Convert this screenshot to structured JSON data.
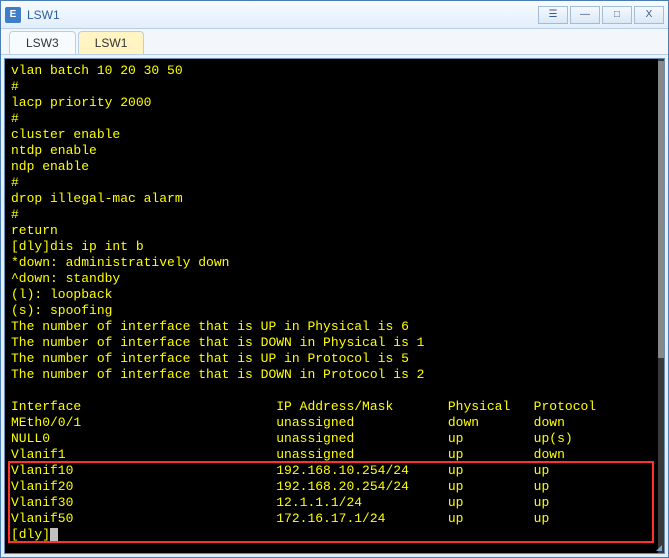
{
  "window": {
    "title": "LSW1",
    "icon_letter": "E",
    "buttons": {
      "menu": "☰",
      "min": "—",
      "max": "□",
      "close": "X"
    }
  },
  "tabs": [
    {
      "label": "LSW3",
      "active": false
    },
    {
      "label": "LSW1",
      "active": true
    }
  ],
  "terminal": {
    "lines": [
      "vlan batch 10 20 30 50",
      "#",
      "lacp priority 2000",
      "#",
      "cluster enable",
      "ntdp enable",
      "ndp enable",
      "#",
      "drop illegal-mac alarm",
      "#",
      "return",
      "[dly]dis ip int b",
      "*down: administratively down",
      "^down: standby",
      "(l): loopback",
      "(s): spoofing",
      "The number of interface that is UP in Physical is 6",
      "The number of interface that is DOWN in Physical is 1",
      "The number of interface that is UP in Protocol is 5",
      "The number of interface that is DOWN in Protocol is 2",
      ""
    ],
    "table_header": {
      "c0": "Interface",
      "c1": "IP Address/Mask",
      "c2": "Physical",
      "c3": "Protocol"
    },
    "rows": [
      {
        "c0": "MEth0/0/1",
        "c1": "unassigned",
        "c2": "down",
        "c3": "down"
      },
      {
        "c0": "NULL0",
        "c1": "unassigned",
        "c2": "up",
        "c3": "up(s)"
      },
      {
        "c0": "Vlanif1",
        "c1": "unassigned",
        "c2": "up",
        "c3": "down"
      },
      {
        "c0": "Vlanif10",
        "c1": "192.168.10.254/24",
        "c2": "up",
        "c3": "up"
      },
      {
        "c0": "Vlanif20",
        "c1": "192.168.20.254/24",
        "c2": "up",
        "c3": "up"
      },
      {
        "c0": "Vlanif30",
        "c1": "12.1.1.1/24",
        "c2": "up",
        "c3": "up"
      },
      {
        "c0": "Vlanif50",
        "c1": "172.16.17.1/24",
        "c2": "up",
        "c3": "up"
      }
    ],
    "prompt": "[dly]"
  }
}
